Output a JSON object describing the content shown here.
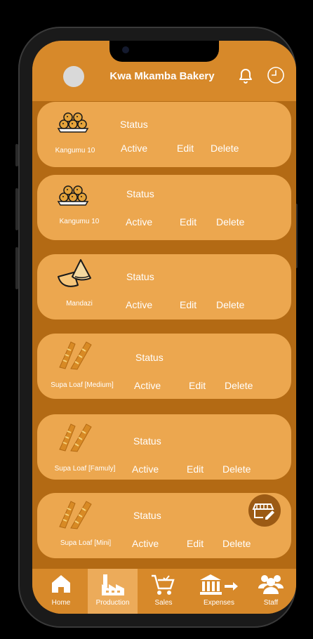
{
  "app": {
    "title": "Kwa Mkamba Bakery"
  },
  "header": {
    "avatar_icon": "avatar",
    "bell_icon": "bell-icon",
    "history_icon": "clock-icon"
  },
  "products": [
    {
      "name": "Kangumu 10",
      "status_label": "Status",
      "active": "Active",
      "edit": "Edit",
      "delete": "Delete",
      "icon": "kangumu-icon"
    },
    {
      "name": "Kangumu 10",
      "status_label": "Status",
      "active": "Active",
      "edit": "Edit",
      "delete": "Delete",
      "icon": "kangumu-icon"
    },
    {
      "name": "Mandazi",
      "status_label": "Status",
      "active": "Active",
      "edit": "Edit",
      "delete": "Delete",
      "icon": "mandazi-icon"
    },
    {
      "name": "Supa Loaf [Medium]",
      "status_label": "Status",
      "active": "Active",
      "edit": "Edit",
      "delete": "Delete",
      "icon": "loaf-icon"
    },
    {
      "name": "Supa Loaf [Famuly]",
      "status_label": "Status",
      "active": "Active",
      "edit": "Edit",
      "delete": "Delete",
      "icon": "loaf-icon"
    },
    {
      "name": "Supa Loaf [Mini]",
      "status_label": "Status",
      "active": "Active",
      "edit": "Edit",
      "delete": "Delete",
      "icon": "loaf-icon"
    }
  ],
  "fab": {
    "icon": "store-edit-icon"
  },
  "nav": [
    {
      "label": "Home",
      "icon": "home-icon",
      "active": false
    },
    {
      "label": "Production",
      "icon": "factory-icon",
      "active": true
    },
    {
      "label": "Sales",
      "icon": "cart-icon",
      "active": false
    },
    {
      "label": "Expenses",
      "icon": "bank-icon",
      "active": false
    },
    {
      "label": "Staff",
      "icon": "staff-icon",
      "active": false
    }
  ],
  "colors": {
    "header": "#d7892a",
    "background": "#b36a14",
    "card": "#eca74f",
    "nav_active": "#ecab5a",
    "fab": "#9b5a14"
  }
}
